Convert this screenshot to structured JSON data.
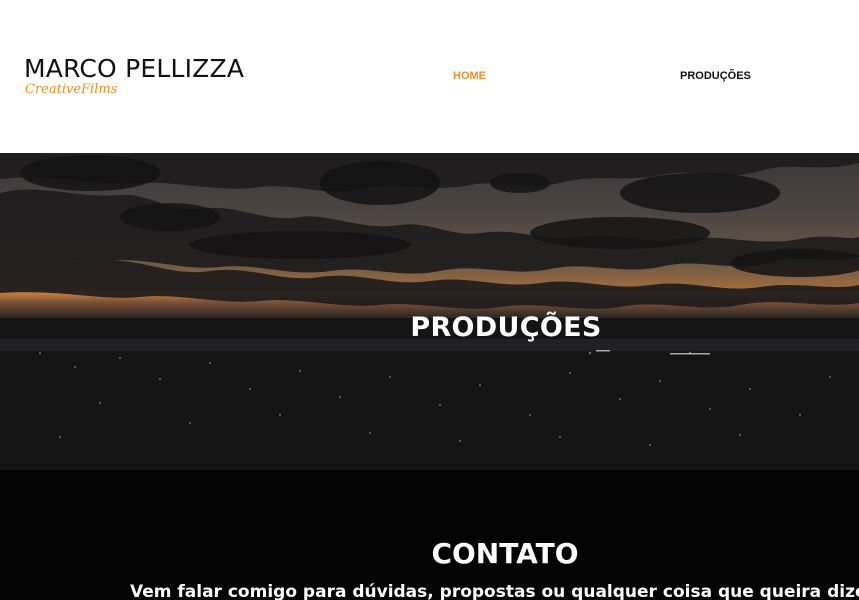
{
  "header": {
    "logo_main": "MARCO PELLIZZA",
    "logo_sub": "CreativeFilms",
    "nav": [
      {
        "label": "HOME",
        "active": true
      },
      {
        "label": "PRODUÇÕES",
        "active": false
      }
    ]
  },
  "hero": {
    "title": "PRODUÇÕES"
  },
  "contact": {
    "title": "CONTATO",
    "text": "Vem falar comigo para dúvidas, propostas ou qualquer coisa que queira dize"
  },
  "colors": {
    "accent": "#e8902a",
    "text_dark": "#111111",
    "contact_bg": "#040404"
  }
}
